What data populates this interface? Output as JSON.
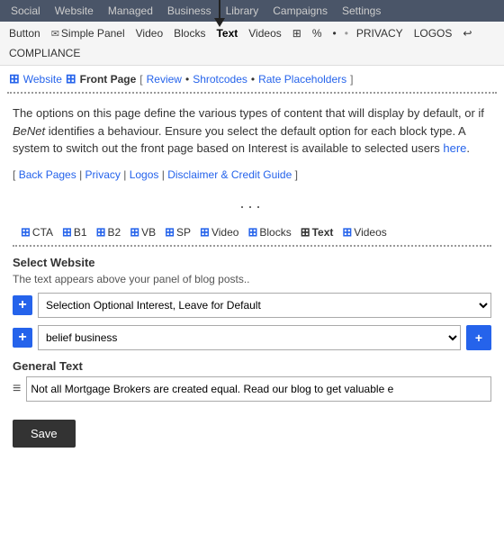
{
  "topnav": {
    "items": [
      "Social",
      "Website",
      "Managed",
      "Business",
      "Library",
      "Campaigns",
      "Settings"
    ]
  },
  "toolbar": {
    "items": [
      {
        "label": "Button",
        "icon": false
      },
      {
        "label": "Simple Panel",
        "icon": true,
        "icon_char": "✉"
      },
      {
        "label": "Video",
        "icon": false
      },
      {
        "label": "Blocks",
        "icon": false
      },
      {
        "label": "Text",
        "icon": false,
        "active": true
      },
      {
        "label": "Videos",
        "icon": false
      },
      {
        "label": "⊞",
        "icon": false
      },
      {
        "label": "%",
        "icon": false
      },
      {
        "label": "•",
        "icon": false
      },
      {
        "label": "PRIVACY",
        "icon": false
      },
      {
        "label": "LOGOS",
        "icon": false
      },
      {
        "label": "↩",
        "icon": false
      },
      {
        "label": "COMPLIANCE",
        "icon": false
      }
    ]
  },
  "breadcrumb": {
    "website_label": "Website",
    "front_page_label": "Front Page",
    "bracket_open": "[",
    "review_label": "Review",
    "dot1": "•",
    "shrotcodes_label": "Shrotcodes",
    "dot2": "•",
    "rate_placeholders_label": "Rate Placeholders",
    "bracket_close": "]"
  },
  "description": {
    "text": "The options on this page define the various types of content that will display by default, or if BeNet identifies a behaviour. Ensure you select the default option for each block type. A system to switch out the front page based on Interest is available to selected users",
    "link_text": "here",
    "italic_text": "BeNet"
  },
  "links_row": {
    "bracket_open": "[",
    "back_pages": "Back Pages",
    "sep1": "|",
    "privacy": "Privacy",
    "sep2": "|",
    "logos": "Logos",
    "sep3": "|",
    "disclaimer": "Disclaimer & Credit Guide",
    "bracket_close": "]"
  },
  "ellipsis": "...",
  "block_tabs": {
    "items": [
      {
        "label": "CTA",
        "plus": true
      },
      {
        "label": "B1",
        "plus": true
      },
      {
        "label": "B2",
        "plus": true
      },
      {
        "label": "VB",
        "plus": true
      },
      {
        "label": "SP",
        "plus": true
      },
      {
        "label": "Video",
        "plus": true
      },
      {
        "label": "Blocks",
        "plus": true
      },
      {
        "label": "Text",
        "plus": true,
        "active": true
      },
      {
        "label": "Videos",
        "plus": true
      }
    ]
  },
  "select_website": {
    "title": "Select Website",
    "description": "The text appears above your panel of blog posts..",
    "dropdown1_value": "Selection Optional Interest, Leave for Default",
    "dropdown1_options": [
      "Selection Optional Interest, Leave for Default"
    ],
    "dropdown2_value": "belief business",
    "dropdown2_options": [
      "belief business"
    ],
    "add_button_label": "+"
  },
  "general_text": {
    "title": "General Text",
    "input_value": "Not all Mortgage Brokers are created equal. Read our blog to get valuable e"
  },
  "footer": {
    "save_label": "Save"
  },
  "arrow": {
    "target_label": "arrow pointing to Text tab"
  }
}
